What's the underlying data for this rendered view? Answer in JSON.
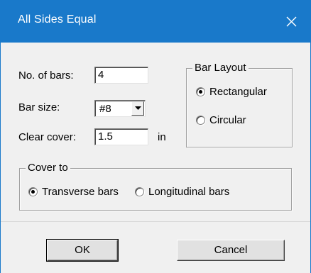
{
  "window": {
    "title": "All Sides Equal",
    "close_glyph": "close-icon",
    "title_color": "#1979ca"
  },
  "form": {
    "num_bars_label": "No. of bars:",
    "num_bars_value": "4",
    "bar_size_label": "Bar size:",
    "bar_size_value": "#8",
    "clear_cover_label": "Clear cover:",
    "clear_cover_value": "1.5",
    "clear_cover_unit": "in"
  },
  "bar_layout": {
    "legend": "Bar Layout",
    "options": [
      {
        "label": "Rectangular",
        "selected": true
      },
      {
        "label": "Circular",
        "selected": false
      }
    ]
  },
  "cover_to": {
    "legend": "Cover to",
    "options": [
      {
        "label": "Transverse bars",
        "selected": true
      },
      {
        "label": "Longitudinal bars",
        "selected": false
      }
    ]
  },
  "buttons": {
    "ok_label": "OK",
    "cancel_label": "Cancel"
  }
}
